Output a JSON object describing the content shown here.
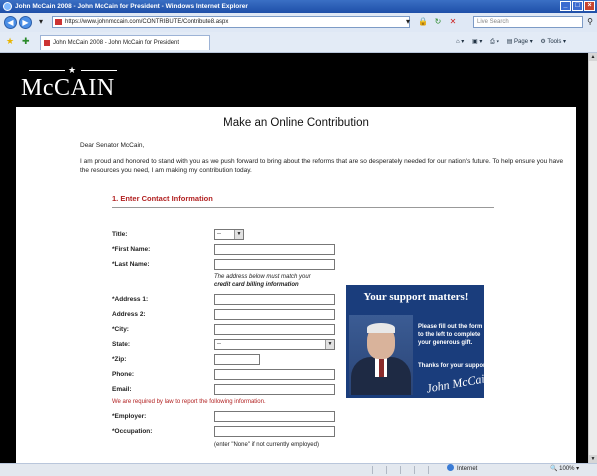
{
  "window": {
    "title": "John McCain 2008 - John McCain for President - Windows Internet Explorer"
  },
  "addressbar": {
    "url": "https://www.johnmccain.com/CONTRIBUTE/Contribute8.aspx",
    "search_placeholder": "Live Search"
  },
  "tab": {
    "label": "John McCain 2008 - John McCain for President"
  },
  "tools": {
    "page": "Page",
    "tools": "Tools"
  },
  "site": {
    "logo": "McCAIN"
  },
  "page": {
    "title": "Make an Online Contribution",
    "greeting": "Dear Senator McCain,",
    "intro": "I am proud and honored to stand with you as we push forward to bring about the reforms that are so desperately needed for our nation's future. To help ensure you have the resources you need, I am making my contribution today."
  },
  "form": {
    "section_title": "1. Enter Contact Information",
    "labels": {
      "title": "Title:",
      "first_name": "*First Name:",
      "last_name": "*Last Name:",
      "address1": "*Address 1:",
      "address2": "Address 2:",
      "city": "*City:",
      "state": "State:",
      "zip": "*Zip:",
      "phone": "Phone:",
      "email": "Email:",
      "employer": "*Employer:",
      "occupation": "*Occupation:"
    },
    "title_value": "--",
    "state_value": "--",
    "address_note_1": "The address below must match your",
    "address_note_2": "credit card billing information",
    "required_notice": "We are required by law to report the following information.",
    "occupation_note": "(enter \"None\" if not currently employed)"
  },
  "ad": {
    "headline": "Your support matters!",
    "text": "Please fill out the form to the left to complete your generous gift.",
    "thanks": "Thanks for your support!",
    "signature": "John McCain"
  },
  "status": {
    "zone": "Internet",
    "zoom": "100%"
  }
}
